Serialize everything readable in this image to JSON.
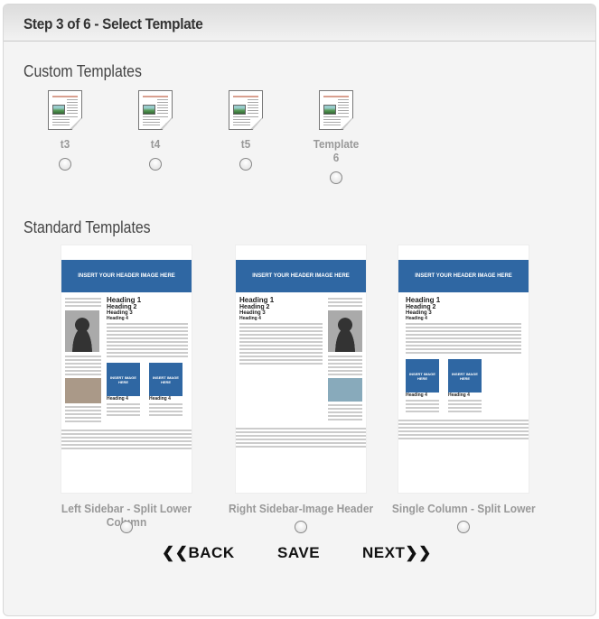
{
  "header": {
    "title": "Step 3 of 6 - Select Template"
  },
  "custom": {
    "title": "Custom Templates",
    "items": [
      {
        "label": "t3"
      },
      {
        "label": "t4"
      },
      {
        "label": "t5"
      },
      {
        "label": "Template 6"
      }
    ]
  },
  "standard": {
    "title": "Standard Templates",
    "header_text": "INSERT YOUR HEADER IMAGE HERE",
    "image_text": "INSERT IMAGE HERE",
    "headings": [
      "Heading 1",
      "Heading 2",
      "Heading 3",
      "Heading 4"
    ],
    "items": [
      {
        "label": "Left Sidebar - Split Lower Column"
      },
      {
        "label": "Right Sidebar-Image Header"
      },
      {
        "label": "Single Column - Split Lower"
      }
    ]
  },
  "nav": {
    "back": "BACK",
    "save": "SAVE",
    "next": "NEXT"
  },
  "colors": {
    "accent": "#2f67a3"
  }
}
